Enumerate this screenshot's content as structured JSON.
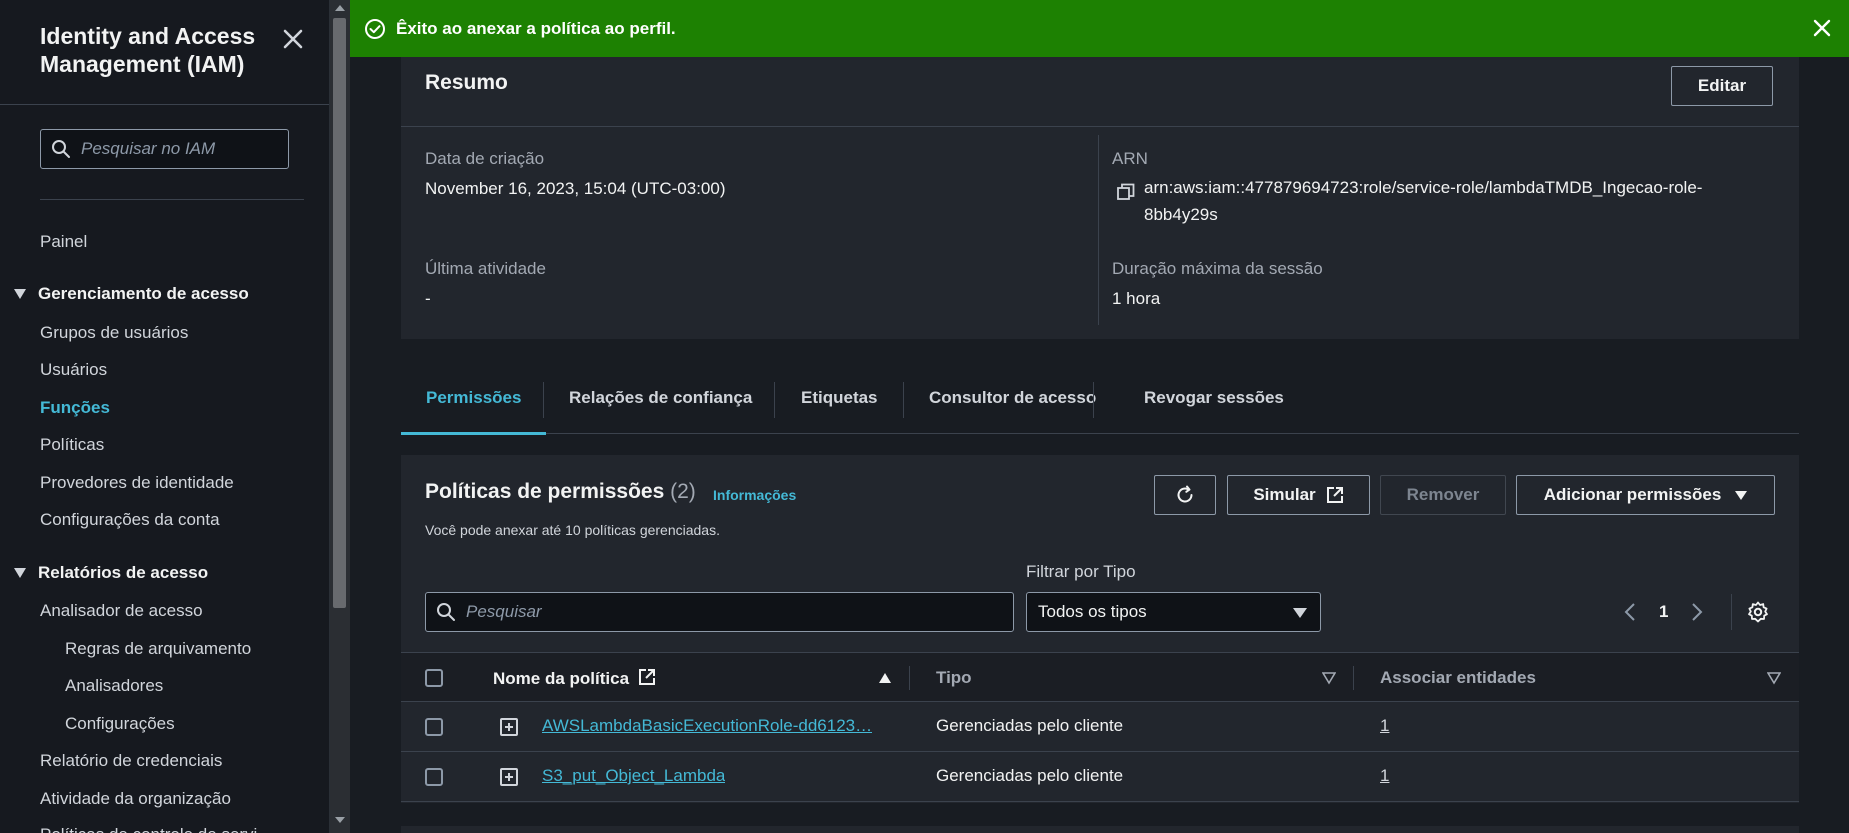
{
  "sidebar": {
    "title": "Identity and Access Management (IAM)",
    "search_placeholder": "Pesquisar no IAM",
    "dashboard": "Painel",
    "section_access_management": "Gerenciamento de acesso",
    "access_items": [
      "Grupos de usuários",
      "Usuários",
      "Funções",
      "Políticas",
      "Provedores de identidade",
      "Configurações da conta"
    ],
    "section_access_reports": "Relatórios de acesso",
    "report_items": [
      "Analisador de acesso",
      "Regras de arquivamento",
      "Analisadores",
      "Configurações",
      "Relatório de credenciais",
      "Atividade da organização",
      "Políticas de controle de servi"
    ]
  },
  "flash": {
    "message": "Êxito ao anexar a política ao perfil.",
    "color": "#1d8102"
  },
  "summary": {
    "title": "Resumo",
    "edit_label": "Editar",
    "created_label": "Data de criação",
    "created_value": "November 16, 2023, 15:04 (UTC-03:00)",
    "last_activity_label": "Última atividade",
    "last_activity_value": "-",
    "arn_label": "ARN",
    "arn_value": "arn:aws:iam::477879694723:role/service-role/lambdaTMDB_Ingecao-role-8bb4y29s",
    "max_session_label": "Duração máxima da sessão",
    "max_session_value": "1 hora"
  },
  "tabs": [
    "Permissões",
    "Relações de confiança",
    "Etiquetas",
    "Consultor de acesso",
    "Revogar sessões"
  ],
  "policies": {
    "title": "Políticas de permissões",
    "count": "(2)",
    "info_link": "Informações",
    "description": "Você pode anexar até 10 políticas gerenciadas.",
    "simulate_label": "Simular",
    "remove_label": "Remover",
    "add_label": "Adicionar permissões",
    "filter_label": "Filtrar por Tipo",
    "search_placeholder": "Pesquisar",
    "filter_value": "Todos os tipos",
    "page": "1",
    "columns": [
      "Nome da política",
      "Tipo",
      "Associar entidades"
    ],
    "rows": [
      {
        "name": "AWSLambdaBasicExecutionRole-dd6123…",
        "type": "Gerenciadas pelo cliente",
        "entities": "1"
      },
      {
        "name": "S3_put_Object_Lambda",
        "type": "Gerenciadas pelo cliente",
        "entities": "1"
      }
    ]
  },
  "colors": {
    "accent": "#44b9d6",
    "success": "#1d8102",
    "background": "#181c22",
    "panel": "#22262d"
  }
}
